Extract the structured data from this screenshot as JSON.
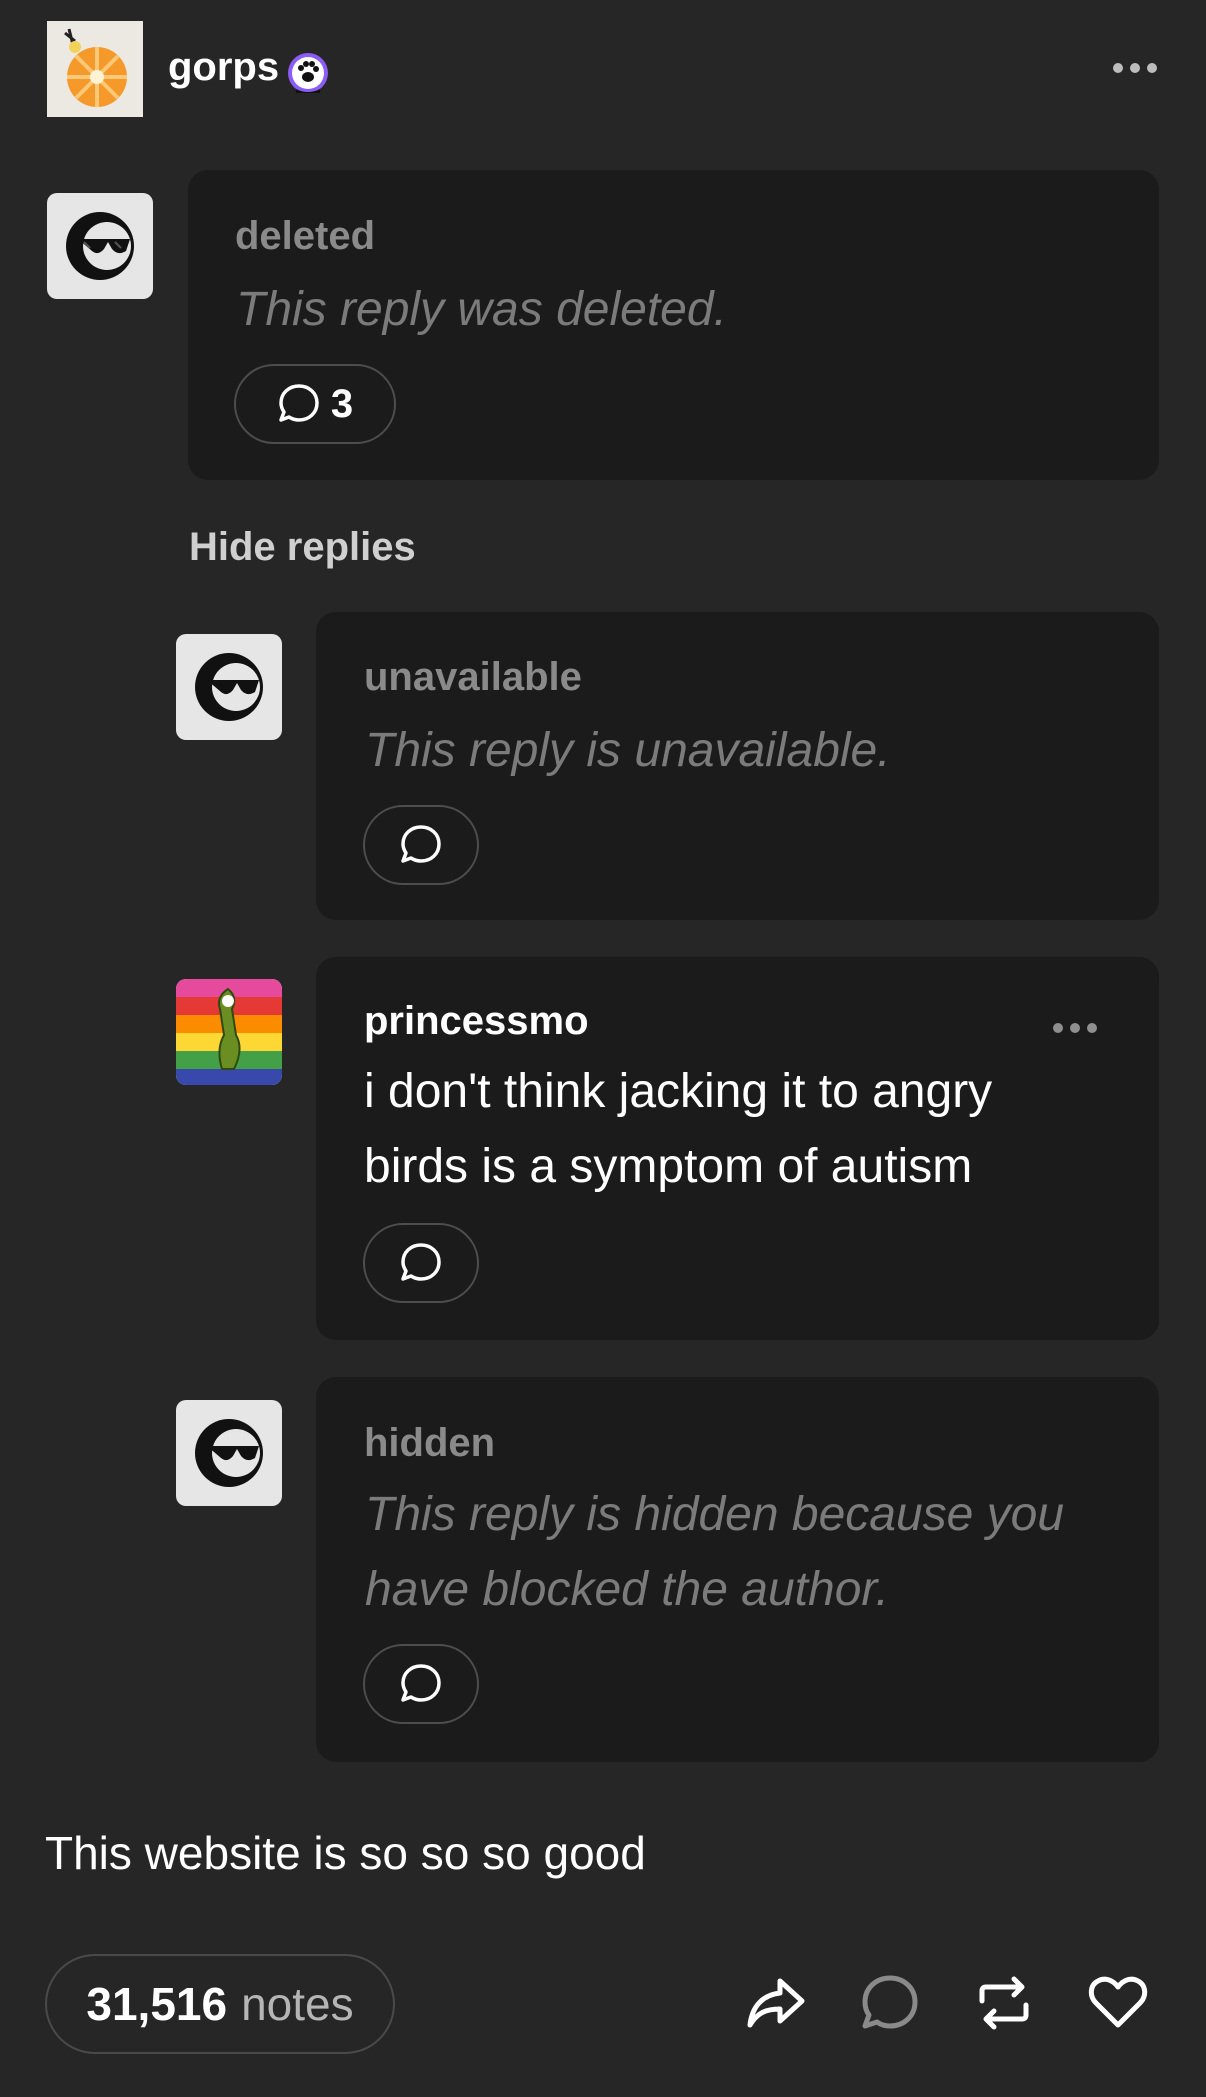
{
  "post": {
    "author": "gorps",
    "caption": "This website is so so so good",
    "notes_count": "31,516",
    "notes_label": "notes"
  },
  "thread": {
    "hide_replies_label": "Hide replies",
    "replies": [
      {
        "username": "deleted",
        "message": "This reply was deleted.",
        "reply_count": "3"
      },
      {
        "username": "unavailable",
        "message": "This reply is unavailable."
      },
      {
        "username": "princessmo",
        "text": "i don't think jacking it to angry birds is a symptom of autism"
      },
      {
        "username": "hidden",
        "message": "This reply is hidden because you have blocked the author."
      }
    ]
  },
  "actions": [
    "share-icon",
    "reply-icon",
    "reblog-icon",
    "like-icon"
  ],
  "colors": {
    "background": "#262626",
    "card": "#1b1b1b",
    "muted": "#7b7b7b",
    "badge": "#8b5cf6"
  }
}
